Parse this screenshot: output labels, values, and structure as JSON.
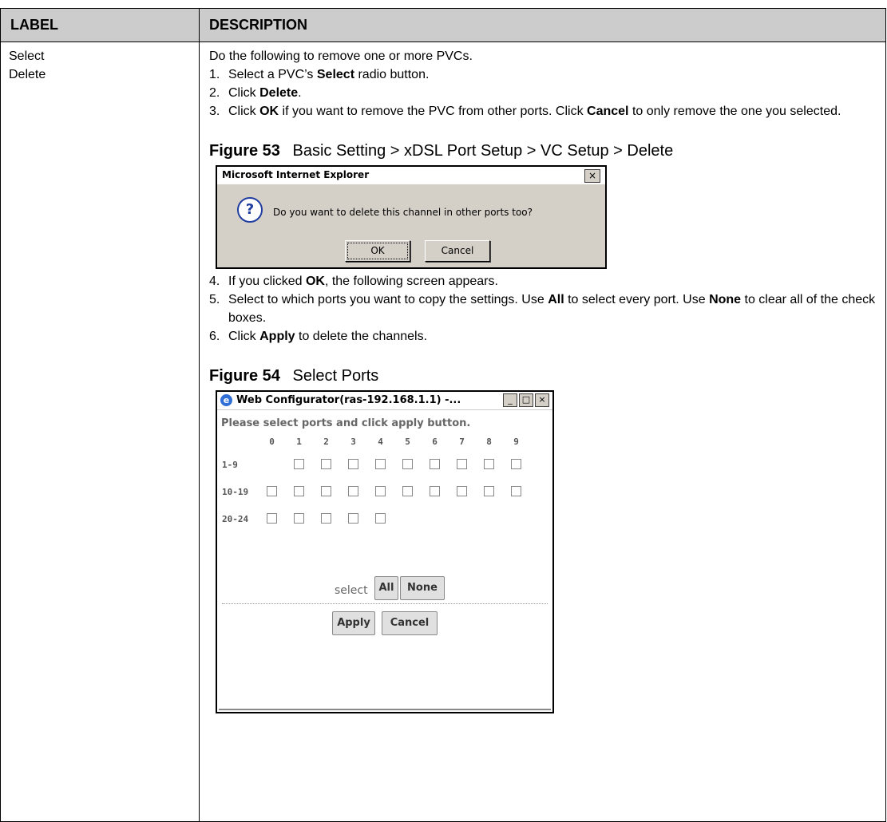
{
  "table": {
    "header_label": "LABEL",
    "header_description": "DESCRIPTION"
  },
  "row": {
    "label_line1": "Select",
    "label_line2": "Delete",
    "intro": "Do the following to remove one or more PVCs.",
    "steps_a": [
      {
        "num": "1.",
        "parts": [
          "Select a PVC’s ",
          "Select",
          " radio button."
        ]
      },
      {
        "num": "2.",
        "parts": [
          "Click ",
          "Delete",
          "."
        ]
      },
      {
        "num": "3.",
        "parts": [
          "Click ",
          "OK",
          " if you want to remove the PVC from other ports. Click ",
          "Cancel",
          " to only remove the one you selected."
        ]
      }
    ],
    "steps_b": [
      {
        "num": "4.",
        "parts": [
          "If you clicked ",
          "OK",
          ", the following screen appears."
        ]
      },
      {
        "num": "5.",
        "parts": [
          "Select to which ports you want to copy the settings. Use ",
          "All",
          " to select every port. Use ",
          "None",
          " to clear all of the check boxes."
        ]
      },
      {
        "num": "6.",
        "parts": [
          "Click ",
          "Apply",
          " to delete the channels."
        ]
      }
    ]
  },
  "figure53": {
    "number": "Figure 53",
    "caption": "Basic Setting > xDSL Port Setup > VC Setup > Delete",
    "dialog_title": "Microsoft Internet Explorer",
    "close_glyph": "×",
    "icon": "question-icon",
    "icon_glyph": "?",
    "message": "Do you want to delete this channel in other ports too?",
    "ok_label": "OK",
    "cancel_label": "Cancel"
  },
  "figure54": {
    "number": "Figure 54",
    "caption": "Select Ports",
    "window_title": "Web Configurator(ras-192.168.1.1) -...",
    "ie_glyph": "e",
    "minimize_glyph": "_",
    "maximize_glyph": "□",
    "close_glyph": "×",
    "instruction": "Please select ports and click apply button.",
    "column_headers": [
      "0",
      "1",
      "2",
      "3",
      "4",
      "5",
      "6",
      "7",
      "8",
      "9"
    ],
    "rows": [
      {
        "label": "1-9",
        "ports": [
          1,
          2,
          3,
          4,
          5,
          6,
          7,
          8,
          9
        ]
      },
      {
        "label": "10-19",
        "ports": [
          0,
          1,
          2,
          3,
          4,
          5,
          6,
          7,
          8,
          9
        ]
      },
      {
        "label": "20-24",
        "ports": [
          0,
          1,
          2,
          3,
          4
        ]
      }
    ],
    "select_label": "select",
    "all_label": "All",
    "none_label": "None",
    "apply_label": "Apply",
    "cancel_label": "Cancel"
  }
}
